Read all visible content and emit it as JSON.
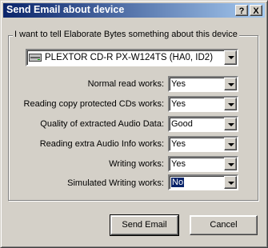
{
  "window": {
    "title": "Send Email about device"
  },
  "titlebar_buttons": {
    "help": "?",
    "close": "X"
  },
  "group": {
    "label": "I want to tell Elaborate Bytes something about this device"
  },
  "device": {
    "value": "PLEXTOR CD-R   PX-W124TS (HA0, ID2)",
    "icon": "cd-drive-icon"
  },
  "fields": [
    {
      "label": "Normal read works:",
      "value": "Yes"
    },
    {
      "label": "Reading copy protected CDs works:",
      "value": "Yes"
    },
    {
      "label": "Quality of extracted Audio Data:",
      "value": "Good"
    },
    {
      "label": "Reading extra Audio Info works:",
      "value": "Yes"
    },
    {
      "label": "Writing works:",
      "value": "Yes"
    },
    {
      "label": "Simulated Writing works:",
      "value": "No"
    }
  ],
  "buttons": {
    "send": "Send Email",
    "cancel": "Cancel"
  }
}
